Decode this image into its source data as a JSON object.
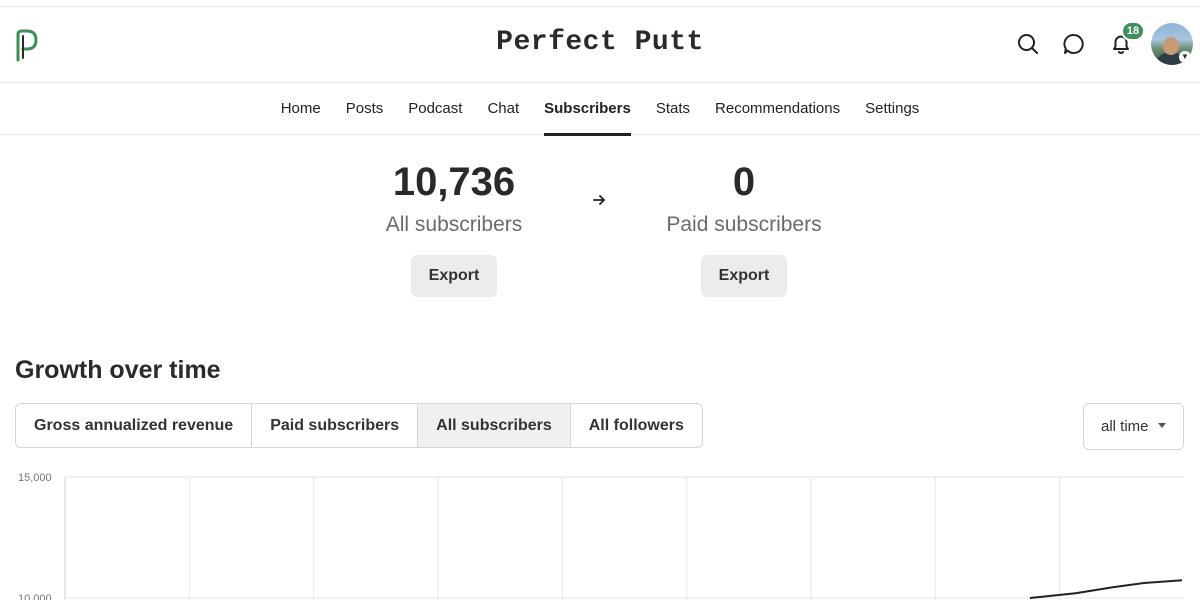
{
  "header": {
    "site_title": "Perfect Putt",
    "notification_count": "18"
  },
  "nav": {
    "items": [
      "Home",
      "Posts",
      "Podcast",
      "Chat",
      "Subscribers",
      "Stats",
      "Recommendations",
      "Settings"
    ],
    "active": "Subscribers"
  },
  "stats": {
    "all": {
      "value": "10,736",
      "label": "All subscribers",
      "export_label": "Export"
    },
    "paid": {
      "value": "0",
      "label": "Paid subscribers",
      "export_label": "Export"
    }
  },
  "growth": {
    "title": "Growth over time",
    "tabs": [
      "Gross annualized revenue",
      "Paid subscribers",
      "All subscribers",
      "All followers"
    ],
    "active_tab": "All subscribers",
    "range_label": "all time"
  },
  "colors": {
    "badge": "#3f8f5b",
    "line": "#222222",
    "grid": "#e6e6e6"
  },
  "chart_data": {
    "type": "line",
    "title": "",
    "xlabel": "",
    "ylabel": "",
    "ytick_labels": [
      "15,000",
      "10,000"
    ],
    "yticks": [
      15000,
      10000
    ],
    "ylim": [
      10000,
      15000
    ],
    "grid": true,
    "series": [
      {
        "x": [
          0,
          0.3,
          0.55,
          0.75,
          1.0
        ],
        "y": [
          10000,
          10200,
          10450,
          10620,
          10736
        ]
      }
    ]
  }
}
